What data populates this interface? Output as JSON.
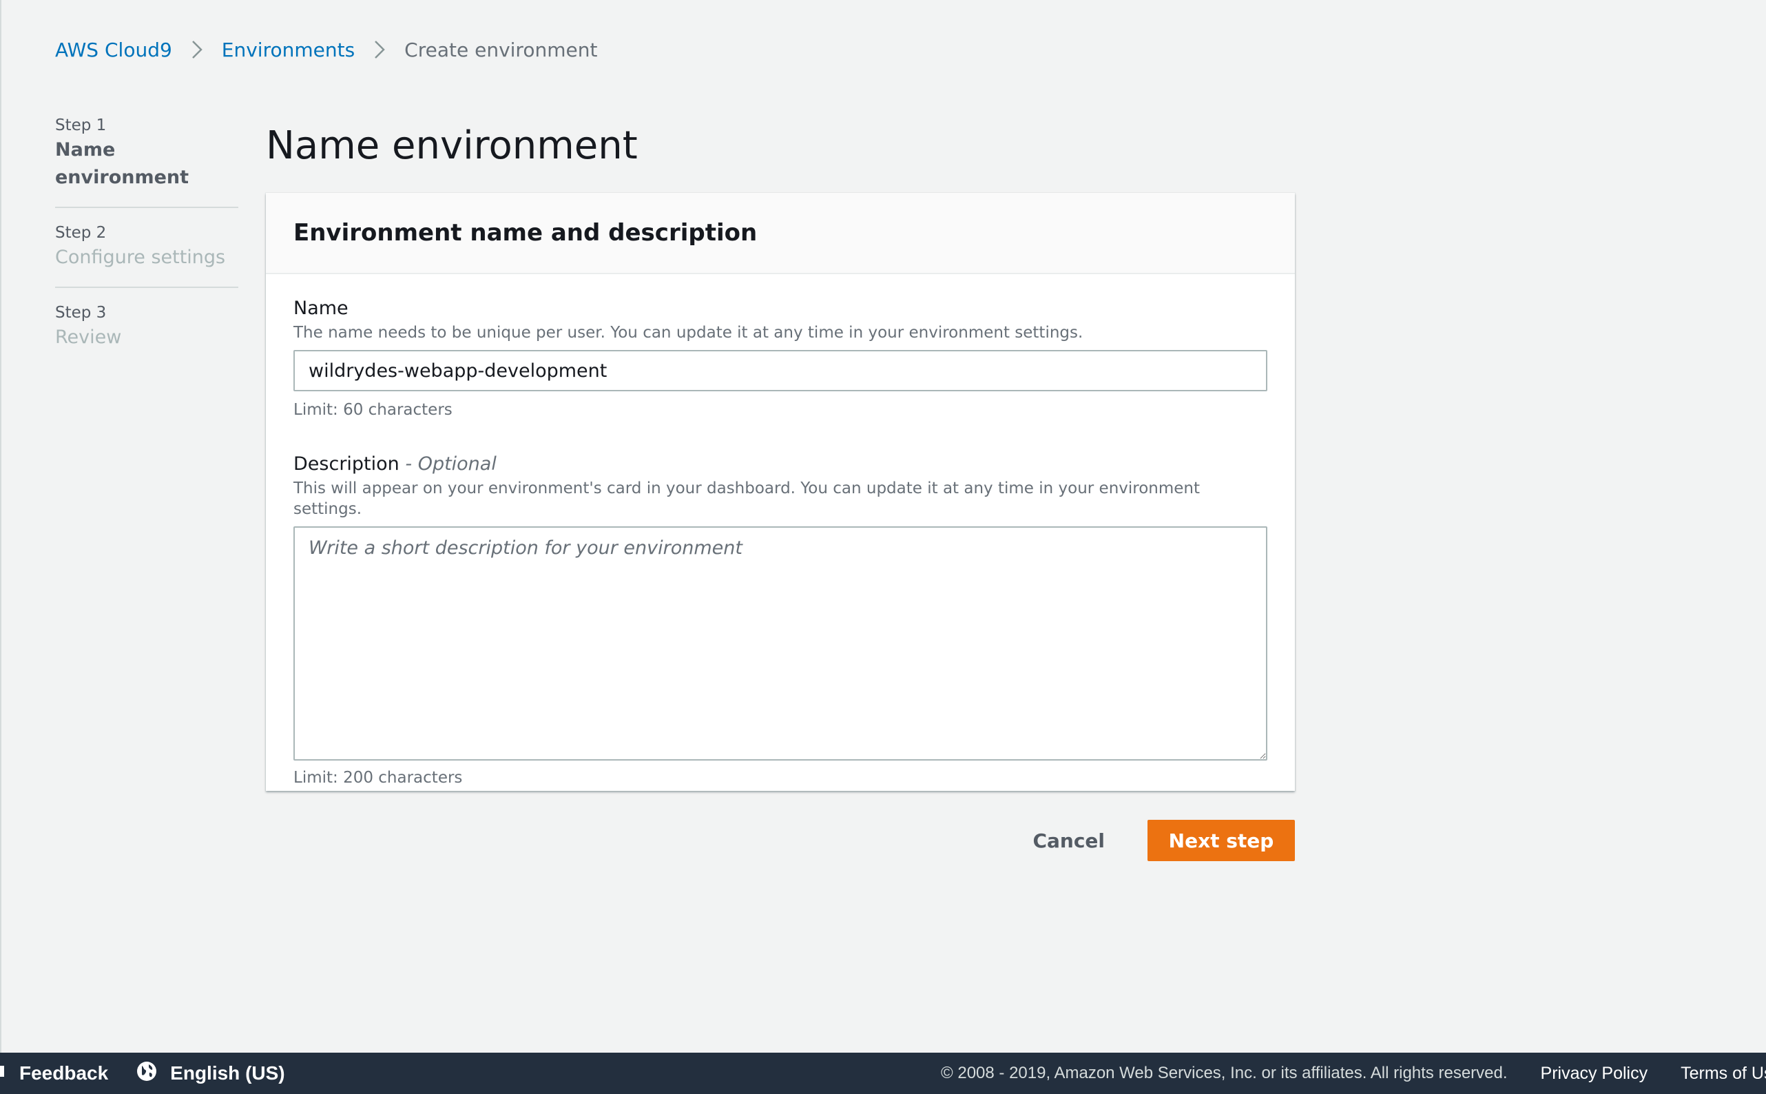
{
  "breadcrumb": {
    "items": [
      {
        "label": "AWS Cloud9"
      },
      {
        "label": "Environments"
      },
      {
        "label": "Create environment"
      }
    ]
  },
  "steps": [
    {
      "number": "Step 1",
      "label": "Name environment",
      "active": true
    },
    {
      "number": "Step 2",
      "label": "Configure settings",
      "active": false
    },
    {
      "number": "Step 3",
      "label": "Review",
      "active": false
    }
  ],
  "page": {
    "title": "Name environment"
  },
  "panel": {
    "title": "Environment name and description",
    "name_field": {
      "label": "Name",
      "hint": "The name needs to be unique per user. You can update it at any time in your environment settings.",
      "value": "wildrydes-webapp-development",
      "limit": "Limit: 60 characters"
    },
    "description_field": {
      "label": "Description",
      "optional": " - Optional",
      "hint": "This will appear on your environment's card in your dashboard. You can update it at any time in your environment settings.",
      "placeholder": "Write a short description for your environment",
      "limit": "Limit: 200 characters"
    }
  },
  "actions": {
    "cancel_label": "Cancel",
    "next_label": "Next step"
  },
  "footer": {
    "feedback_label": "Feedback",
    "language_label": "English (US)",
    "copyright": "© 2008 - 2019, Amazon Web Services, Inc. or its affiliates. All rights reserved.",
    "privacy_label": "Privacy Policy",
    "terms_label": "Terms of Use"
  },
  "colors": {
    "link": "#0073bb",
    "primary_button": "#ec7211",
    "footer_bg": "#232f3e",
    "page_bg": "#f2f3f3"
  },
  "icons": {
    "breadcrumb_separator": "chevron-right-icon",
    "feedback": "feedback-icon",
    "language": "globe-icon",
    "textarea_resize": "resize-handle-icon"
  }
}
